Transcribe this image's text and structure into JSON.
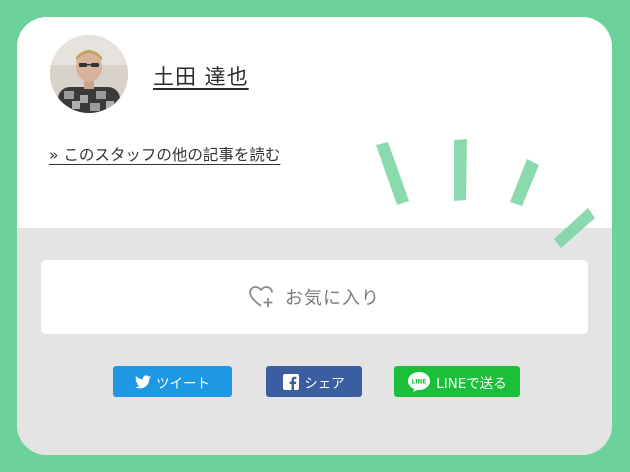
{
  "author": {
    "name": "土田 達也",
    "more_articles_link": "» このスタッフの他の記事を読む"
  },
  "favorite": {
    "label": "お気に入り",
    "icon": "heart-plus-icon"
  },
  "share": {
    "twitter": {
      "label": "ツイート",
      "icon": "twitter-bird-icon",
      "color": "#1f98e3"
    },
    "facebook": {
      "label": "シェア",
      "icon": "facebook-icon",
      "color": "#3d5da1"
    },
    "line": {
      "label": "LINEで送る",
      "icon": "line-icon",
      "color": "#1cbf3a"
    }
  },
  "colors": {
    "page_background": "#6dd19c",
    "card_background": "#ffffff",
    "lower_panel": "#e4e4e4",
    "decoration": "#7fd6a6"
  }
}
